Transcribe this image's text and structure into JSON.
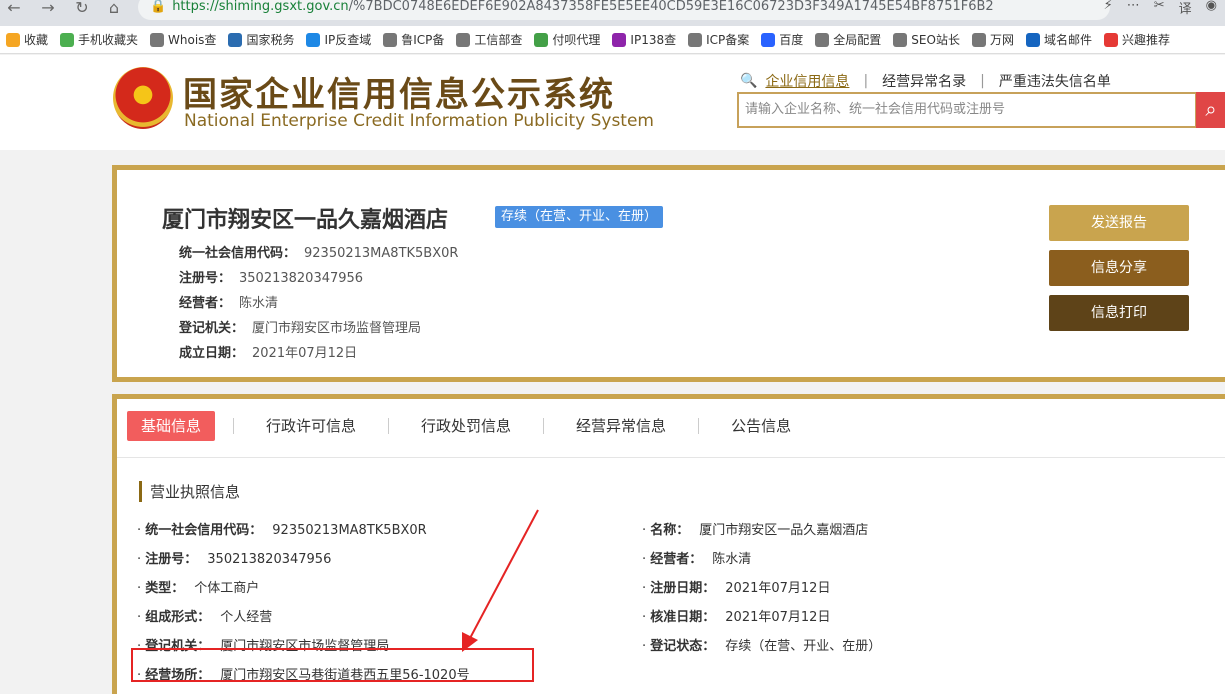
{
  "browser": {
    "url_host": "https://shiming.gsxt.gov.cn",
    "url_path": "/%7BDC0748E6EDEF6E902A8437358FE5E5EE40CD59E3E16C06723D3F349A1745E54BF8751F6B2"
  },
  "bookmarks": [
    {
      "label": "收藏",
      "icon": "star-icon",
      "color": "#f5a623"
    },
    {
      "label": "手机收藏夹",
      "icon": "phone-icon",
      "color": "#4caf50"
    },
    {
      "label": "Whois查",
      "icon": "globe-icon",
      "color": "#777777"
    },
    {
      "label": "国家税务",
      "icon": "tax-icon",
      "color": "#2b6cb0"
    },
    {
      "label": "IP反查域",
      "icon": "ip-icon",
      "color": "#1e88e5"
    },
    {
      "label": "鲁ICP备",
      "icon": "globe-icon",
      "color": "#777777"
    },
    {
      "label": "工信部查",
      "icon": "globe-icon",
      "color": "#777777"
    },
    {
      "label": "付呗代理",
      "icon": "leaf-icon",
      "color": "#43a047"
    },
    {
      "label": "IP138查",
      "icon": "ip138-icon",
      "color": "#8e24aa"
    },
    {
      "label": "ICP备案",
      "icon": "globe-icon",
      "color": "#777777"
    },
    {
      "label": "百度",
      "icon": "paw-icon",
      "color": "#2962ff"
    },
    {
      "label": "全局配置",
      "icon": "globe-icon",
      "color": "#777777"
    },
    {
      "label": "SEO站长",
      "icon": "globe-icon",
      "color": "#777777"
    },
    {
      "label": "万网",
      "icon": "globe-icon",
      "color": "#777777"
    },
    {
      "label": "域名邮件",
      "icon": "mail-icon",
      "color": "#1565c0"
    },
    {
      "label": "兴趣推荐",
      "icon": "weibo-icon",
      "color": "#e53935"
    }
  ],
  "header": {
    "brand_cn": "国家企业信用信息公示系统",
    "brand_en": "National Enterprise Credit Information Publicity System",
    "links": [
      "企业信用信息",
      "经营异常名录",
      "严重违法失信名单"
    ],
    "search_placeholder": "请输入企业名称、统一社会信用代码或注册号"
  },
  "company": {
    "name": "厦门市翔安区一品久嘉烟酒店",
    "status": "存续（在营、开业、在册）",
    "rows": [
      {
        "label": "统一社会信用代码：",
        "value": "92350213MA8TK5BX0R"
      },
      {
        "label": "注册号：",
        "value": "350213820347956"
      },
      {
        "label": "经营者：",
        "value": "陈水清"
      },
      {
        "label": "登记机关：",
        "value": "厦门市翔安区市场监督管理局"
      },
      {
        "label": "成立日期：",
        "value": "2021年07月12日"
      }
    ],
    "actions": {
      "send": "发送报告",
      "share": "信息分享",
      "print": "信息打印"
    }
  },
  "tabs": [
    "基础信息",
    "行政许可信息",
    "行政处罚信息",
    "经营异常信息",
    "公告信息"
  ],
  "license": {
    "title": "营业执照信息",
    "left": [
      {
        "label": "统一社会信用代码：",
        "value": "92350213MA8TK5BX0R"
      },
      {
        "label": "注册号：",
        "value": "350213820347956"
      },
      {
        "label": "类型：",
        "value": "个体工商户"
      },
      {
        "label": "组成形式：",
        "value": "个人经营"
      },
      {
        "label": "登记机关：",
        "value": "厦门市翔安区市场监督管理局"
      },
      {
        "label": "经营场所：",
        "value": "厦门市翔安区马巷街道巷西五里56-1020号"
      }
    ],
    "right": [
      {
        "label": "名称：",
        "value": "厦门市翔安区一品久嘉烟酒店"
      },
      {
        "label": "经营者：",
        "value": "陈水清"
      },
      {
        "label": "注册日期：",
        "value": "2021年07月12日"
      },
      {
        "label": "核准日期：",
        "value": "2021年07月12日"
      },
      {
        "label": "登记状态：",
        "value": "存续（在营、开业、在册）"
      }
    ]
  },
  "colors": {
    "gold": "#c9a44e",
    "brown": "#8b6914",
    "red": "#e52424",
    "tab_active": "#f25d5d"
  }
}
